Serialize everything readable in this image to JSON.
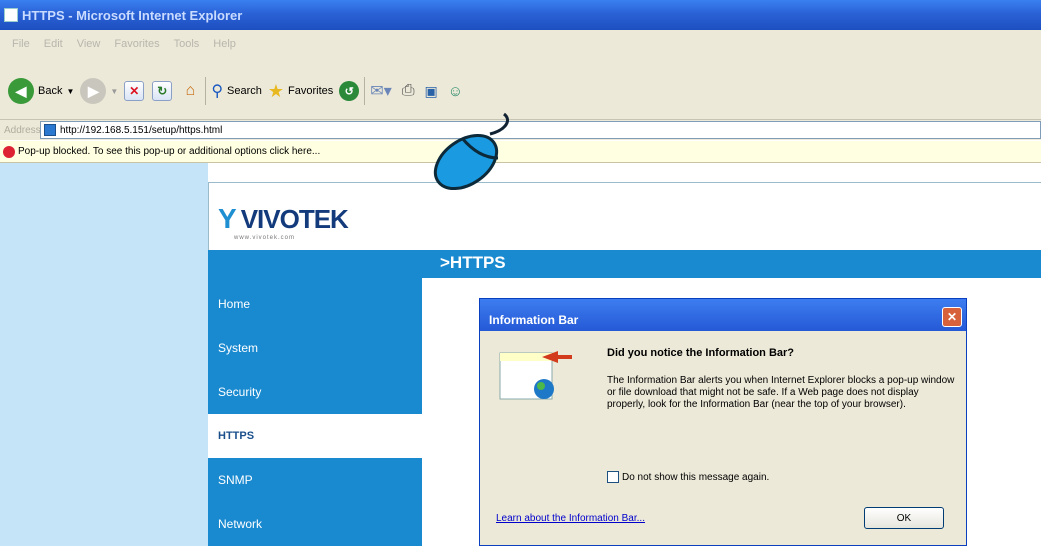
{
  "window": {
    "title": "HTTPS - Microsoft Internet Explorer"
  },
  "menu": [
    "File",
    "Edit",
    "View",
    "Favorites",
    "Tools",
    "Help"
  ],
  "toolbar": {
    "back_label": "Back",
    "search_label": "Search",
    "favorites_label": "Favorites"
  },
  "address": {
    "label": "Address",
    "url": "http://192.168.5.151/setup/https.html"
  },
  "infobar": {
    "text": "Pop-up blocked. To see this pop-up or additional options click here..."
  },
  "page": {
    "logo": {
      "brand": "VIVOTEK",
      "sub": "www.vivotek.com"
    },
    "header_title": ">HTTPS",
    "nav": [
      "Home",
      "System",
      "Security",
      "HTTPS",
      "SNMP",
      "Network"
    ],
    "nav_active": "HTTPS"
  },
  "dialog": {
    "title": "Information Bar",
    "question": "Did you notice the Information Bar?",
    "body": "The Information Bar alerts you when Internet Explorer blocks a pop-up window or file download that might not be safe. If a Web page does not display properly, look for the Information Bar (near the top of your browser).",
    "checkbox_label": "Do not show this message again.",
    "link": "Learn about the Information Bar...",
    "ok": "OK"
  },
  "colors": {
    "accent": "#1a8ad0",
    "titlebar": "#2a62d6",
    "infobar": "#ffffe1",
    "leftband": "#c5e4f8"
  }
}
